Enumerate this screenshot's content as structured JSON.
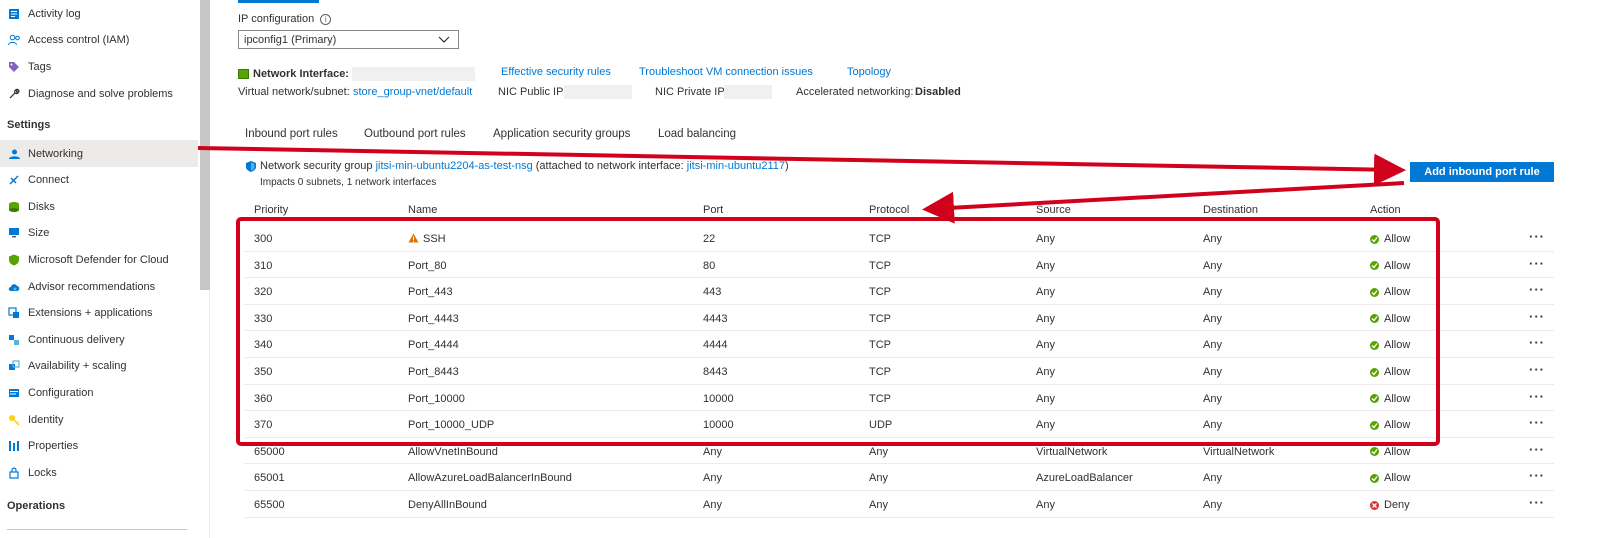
{
  "sidebar": {
    "items": [
      {
        "label": "Activity log",
        "icon": "activity-log-icon",
        "top": 0
      },
      {
        "label": "Access control (IAM)",
        "icon": "people-icon"
      },
      {
        "label": "Tags",
        "icon": "tag-icon"
      },
      {
        "label": "Diagnose and solve problems",
        "icon": "wrench-icon"
      }
    ],
    "settings_heading": "Settings",
    "settings_items": [
      {
        "label": "Networking",
        "icon": "networking-icon"
      },
      {
        "label": "Connect",
        "icon": "connect-icon"
      },
      {
        "label": "Disks",
        "icon": "disks-icon"
      },
      {
        "label": "Size",
        "icon": "monitor-icon"
      },
      {
        "label": "Microsoft Defender for Cloud",
        "icon": "shield-icon"
      },
      {
        "label": "Advisor recommendations",
        "icon": "cloud-advisor-icon"
      },
      {
        "label": "Extensions + applications",
        "icon": "extensions-icon"
      },
      {
        "label": "Continuous delivery",
        "icon": "delivery-icon"
      },
      {
        "label": "Availability + scaling",
        "icon": "scaling-icon"
      },
      {
        "label": "Configuration",
        "icon": "configuration-icon"
      },
      {
        "label": "Identity",
        "icon": "key-icon"
      },
      {
        "label": "Properties",
        "icon": "properties-icon"
      },
      {
        "label": "Locks",
        "icon": "lock-icon"
      }
    ],
    "operations_heading": "Operations"
  },
  "ipconfig": {
    "label": "IP configuration",
    "selected": "ipconfig1 (Primary)"
  },
  "nic": {
    "label": "Network Interface:",
    "effective_rules": "Effective security rules",
    "troubleshoot": "Troubleshoot VM connection issues",
    "topology": "Topology",
    "vnet_label": "Virtual network/subnet:",
    "vnet_value": "store_group-vnet/default",
    "public_ip_label": "NIC Public IP:",
    "private_ip_label": "NIC Private IP:",
    "accel_label": "Accelerated networking:",
    "accel_value": "Disabled"
  },
  "tabs": [
    "Inbound port rules",
    "Outbound port rules",
    "Application security groups",
    "Load balancing"
  ],
  "nsg": {
    "prefix": "Network security group",
    "name": "jitsi-min-ubuntu2204-as-test-nsg",
    "attached_prefix": "(attached to network interface:",
    "interface": "jitsi-min-ubuntu2117",
    "attached_suffix": ")",
    "impacts": "Impacts 0 subnets, 1 network interfaces"
  },
  "add_rule_label": "Add inbound port rule",
  "table": {
    "headers": [
      "Priority",
      "Name",
      "Port",
      "Protocol",
      "Source",
      "Destination",
      "Action"
    ],
    "rows": [
      {
        "priority": "300",
        "name": "SSH",
        "warning": true,
        "port": "22",
        "protocol": "TCP",
        "source": "Any",
        "destination": "Any",
        "action": "Allow"
      },
      {
        "priority": "310",
        "name": "Port_80",
        "port": "80",
        "protocol": "TCP",
        "source": "Any",
        "destination": "Any",
        "action": "Allow"
      },
      {
        "priority": "320",
        "name": "Port_443",
        "port": "443",
        "protocol": "TCP",
        "source": "Any",
        "destination": "Any",
        "action": "Allow"
      },
      {
        "priority": "330",
        "name": "Port_4443",
        "port": "4443",
        "protocol": "TCP",
        "source": "Any",
        "destination": "Any",
        "action": "Allow"
      },
      {
        "priority": "340",
        "name": "Port_4444",
        "port": "4444",
        "protocol": "TCP",
        "source": "Any",
        "destination": "Any",
        "action": "Allow"
      },
      {
        "priority": "350",
        "name": "Port_8443",
        "port": "8443",
        "protocol": "TCP",
        "source": "Any",
        "destination": "Any",
        "action": "Allow"
      },
      {
        "priority": "360",
        "name": "Port_10000",
        "port": "10000",
        "protocol": "TCP",
        "source": "Any",
        "destination": "Any",
        "action": "Allow"
      },
      {
        "priority": "370",
        "name": "Port_10000_UDP",
        "port": "10000",
        "protocol": "UDP",
        "source": "Any",
        "destination": "Any",
        "action": "Allow"
      },
      {
        "priority": "65000",
        "name": "AllowVnetInBound",
        "port": "Any",
        "protocol": "Any",
        "source": "VirtualNetwork",
        "destination": "VirtualNetwork",
        "action": "Allow"
      },
      {
        "priority": "65001",
        "name": "AllowAzureLoadBalancerInBound",
        "port": "Any",
        "protocol": "Any",
        "source": "AzureLoadBalancer",
        "destination": "Any",
        "action": "Allow"
      },
      {
        "priority": "65500",
        "name": "DenyAllInBound",
        "port": "Any",
        "protocol": "Any",
        "source": "Any",
        "destination": "Any",
        "action": "Deny"
      }
    ],
    "more_label": "···"
  },
  "colors": {
    "accent": "#0078d4",
    "allow": "#57a300",
    "deny": "#d13438",
    "annotation": "#d0021b"
  }
}
